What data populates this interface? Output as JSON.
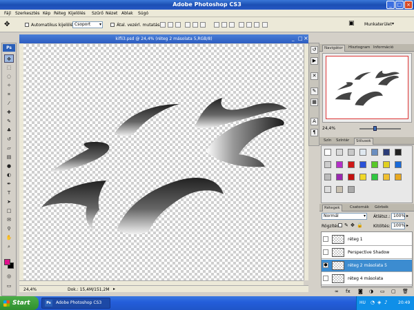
{
  "window": {
    "title": "Adobe Photoshop CS3",
    "min": "_",
    "max": "□",
    "close": "×"
  },
  "menu": [
    "Fájl",
    "Szerkesztés",
    "Kép",
    "Réteg",
    "Kijelölés",
    "Szűrő",
    "Nézet",
    "Ablak",
    "Súgó"
  ],
  "options": {
    "auto_select_label": "Automatikus kijelölés:",
    "auto_select_value": "Csoport",
    "transform_label": "Átal. vezérl. mutatása",
    "workspace_label": "Munkaterület"
  },
  "document": {
    "title": "kifli3.psd @ 24,4% (réteg 2 másolata 5,RGB/8)",
    "zoom": "24,4%",
    "doc_info": "Dok.: 15,4M/151,2M"
  },
  "navigator": {
    "tabs": [
      "Navigátor",
      "Hisztogram",
      "Információ"
    ],
    "zoom": "24,4%"
  },
  "styles_panel": {
    "tabs": [
      "Szín",
      "Színtár",
      "Stílusok"
    ]
  },
  "layers_panel": {
    "tabs": [
      "Rétegek",
      "Csatornák",
      "Görbék"
    ],
    "blend_mode": "Normál",
    "opacity_label": "Átlátsz.:",
    "opacity_value": "100%",
    "lock_label": "Rögzítés:",
    "fill_label": "Kitöltés:",
    "fill_value": "100%",
    "layers": [
      {
        "name": "réteg 1",
        "selected": false
      },
      {
        "name": "Perspective Shadow",
        "selected": false
      },
      {
        "name": "réteg 2 másolata 5",
        "selected": true
      },
      {
        "name": "réteg 4 másolata",
        "selected": false
      }
    ]
  },
  "taskbar": {
    "start": "Start",
    "task": "Adobe Photoshop CS3",
    "lang": "HU",
    "time": "20:49"
  },
  "colors": {
    "foreground": "#e0108c",
    "background": "#000000",
    "accent": "#3c8cd0"
  }
}
